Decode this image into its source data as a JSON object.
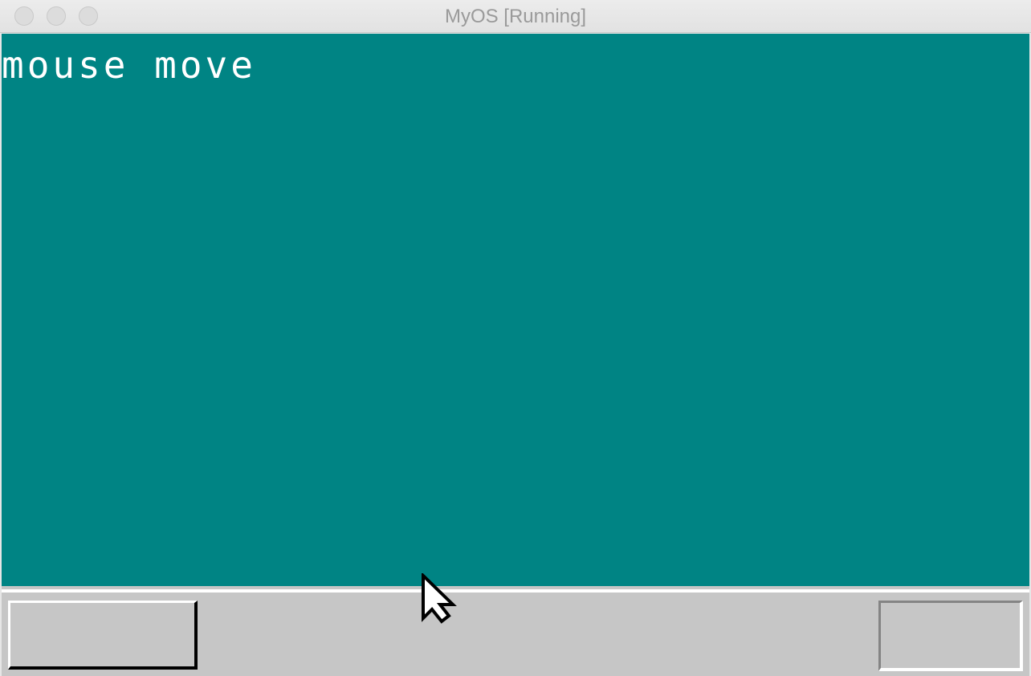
{
  "window": {
    "title": "MyOS [Running]"
  },
  "screen": {
    "background_color": "#008484",
    "text": "mouse move"
  },
  "taskbar": {
    "background_color": "#c6c6c6"
  },
  "icons": {
    "cursor": "arrow-cursor-icon"
  }
}
